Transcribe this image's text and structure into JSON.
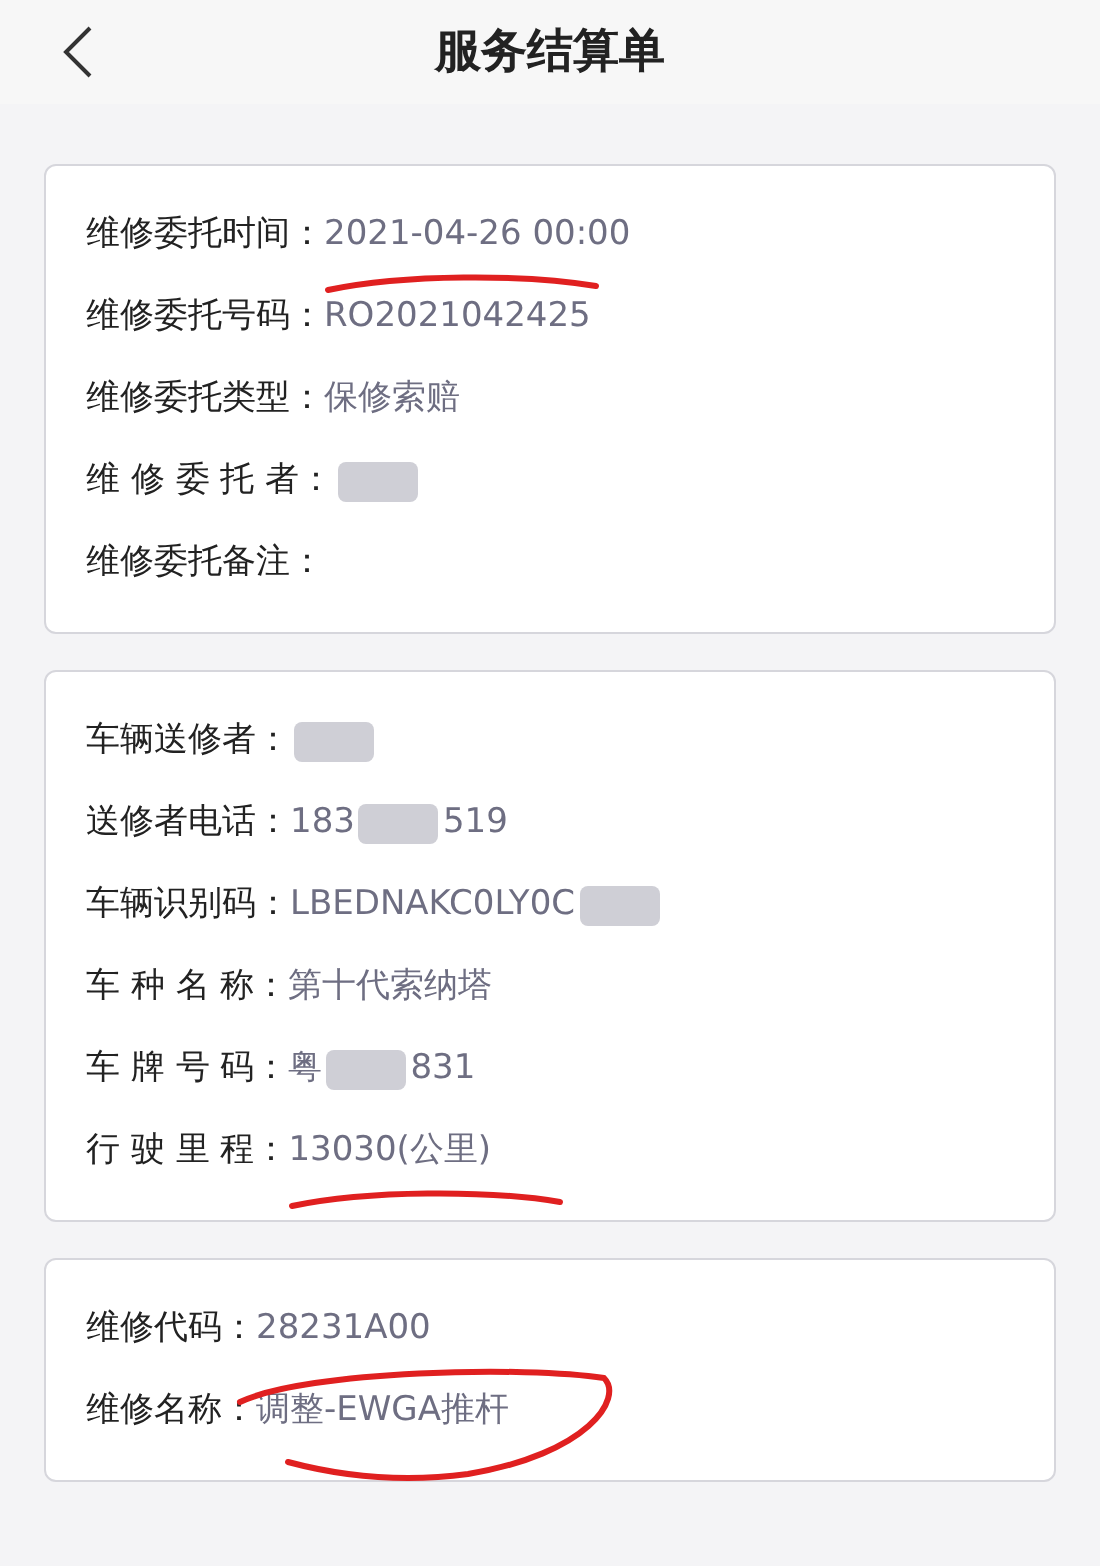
{
  "header": {
    "title": "服务结算单"
  },
  "cards": [
    {
      "rows": [
        {
          "label": "维修委托时间：",
          "annotation": {
            "kind": "underline"
          },
          "value": [
            {
              "kind": "text",
              "text": "2021-04-26 00:00"
            }
          ]
        },
        {
          "label": "维修委托号码：",
          "value": [
            {
              "kind": "text",
              "text": "RO2021042425"
            }
          ]
        },
        {
          "label": "维修委托类型：",
          "value": [
            {
              "kind": "text",
              "text": "保修索赔"
            }
          ]
        },
        {
          "label": "维 修 委 托 者：",
          "value": [
            {
              "kind": "redacted"
            }
          ]
        },
        {
          "label": "维修委托备注：",
          "value": []
        }
      ]
    },
    {
      "rows": [
        {
          "label": "车辆送修者：",
          "value": [
            {
              "kind": "redacted"
            }
          ]
        },
        {
          "label": "送修者电话：",
          "value": [
            {
              "kind": "text",
              "text": "183"
            },
            {
              "kind": "redacted"
            },
            {
              "kind": "text",
              "text": "519"
            }
          ]
        },
        {
          "label": "车辆识别码：",
          "value": [
            {
              "kind": "text",
              "text": "LBEDNAKC0LY0C"
            },
            {
              "kind": "redacted"
            }
          ]
        },
        {
          "label": "车 种 名 称：",
          "value": [
            {
              "kind": "text",
              "text": "第十代索纳塔"
            }
          ]
        },
        {
          "label": "车 牌 号 码：",
          "value": [
            {
              "kind": "text",
              "text": "粤"
            },
            {
              "kind": "redacted"
            },
            {
              "kind": "text",
              "text": "831"
            }
          ]
        },
        {
          "label": "行 驶 里 程：",
          "annotation": {
            "kind": "underline"
          },
          "value": [
            {
              "kind": "text",
              "text": "13030(公里)"
            }
          ]
        }
      ]
    },
    {
      "rows": [
        {
          "label": "维修代码：",
          "value": [
            {
              "kind": "text",
              "text": "28231A00"
            }
          ]
        },
        {
          "label": "维修名称：",
          "annotation": {
            "kind": "circle"
          },
          "value": [
            {
              "kind": "text",
              "text": "调整-EWGA推杆"
            }
          ]
        }
      ]
    }
  ]
}
